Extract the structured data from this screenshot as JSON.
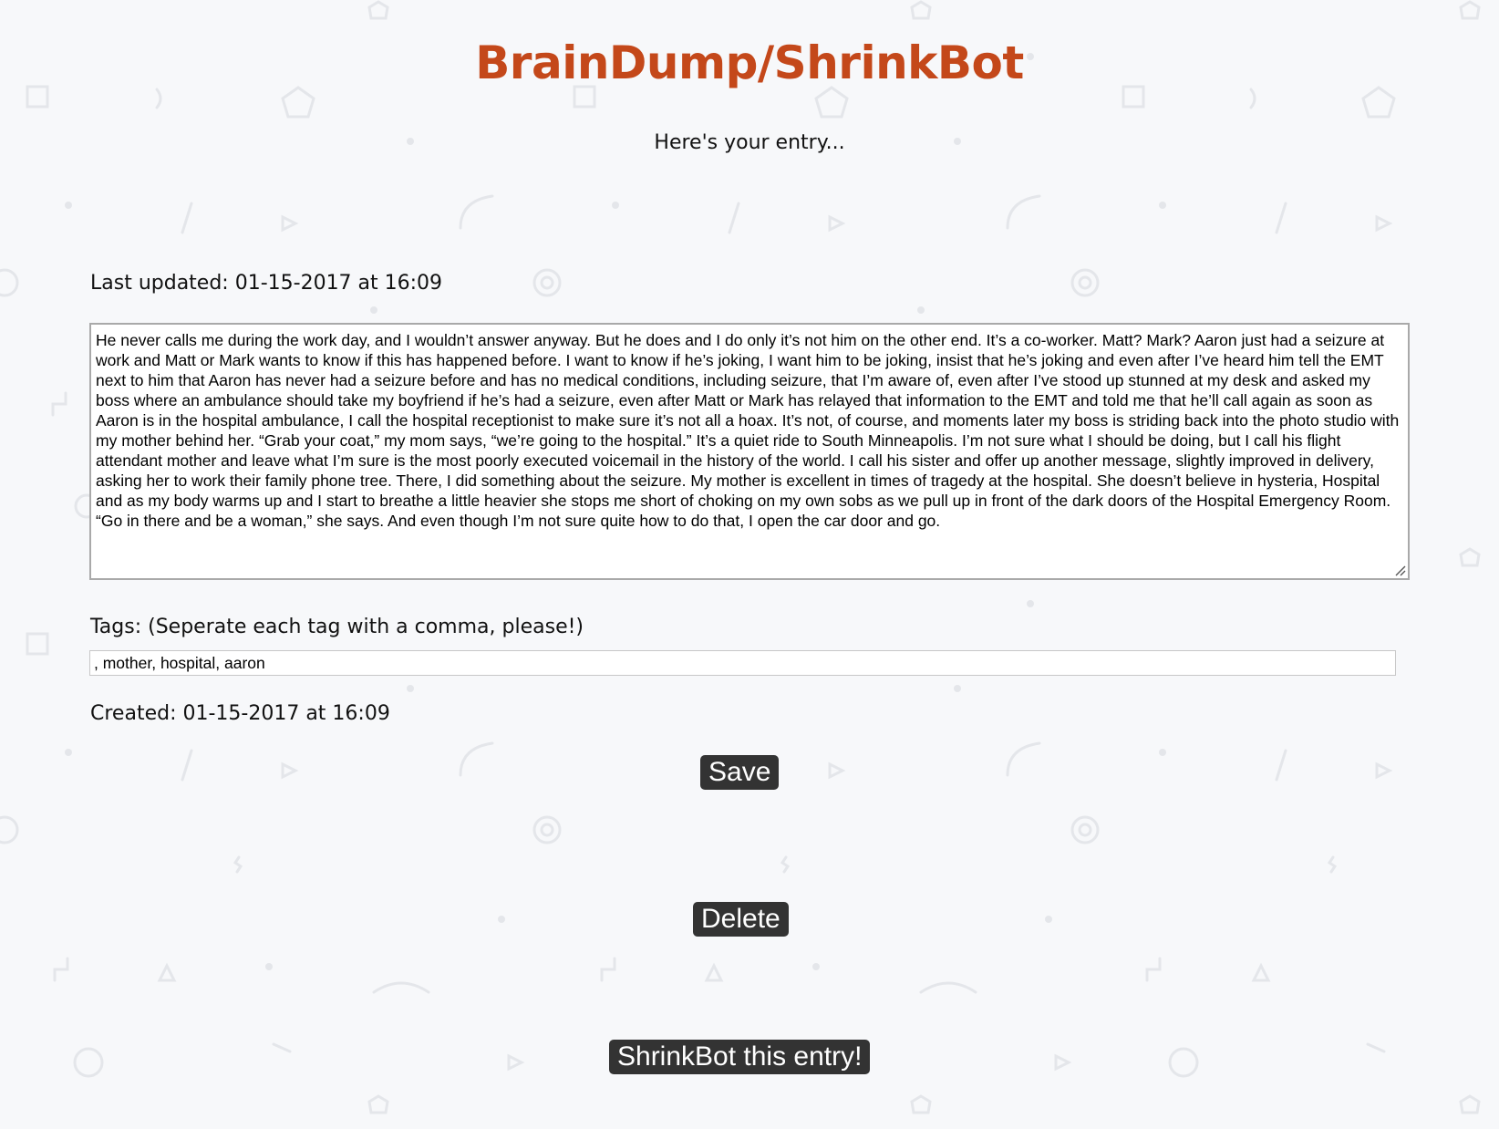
{
  "header": {
    "title": "BrainDump/ShrinkBot",
    "subtitle": "Here's your entry..."
  },
  "entry": {
    "last_updated": "Last updated: 01-15-2017 at 16:09",
    "body": "He never calls me during the work day, and I wouldn’t answer anyway. But he does and I do only it’s not him on the other end. It’s a co-worker. Matt? Mark? Aaron just had a seizure at work and Matt or Mark wants to know if this has happened before. I want to know if he’s joking, I want him to be joking, insist that he’s joking and even after I’ve heard him tell the EMT next to him that Aaron has never had a seizure before and has no medical conditions, including seizure, that I’m aware of, even after I’ve stood up stunned at my desk and asked my boss where an ambulance should take my boyfriend if he’s had a seizure, even after Matt or Mark has relayed that information to the EMT and told me that he’ll call again as soon as Aaron is in the hospital ambulance, I call the hospital receptionist to make sure it’s not all a hoax. It’s not, of course, and moments later my boss is striding back into the photo studio with my mother behind her. “Grab your coat,” my mom says, “we’re going to the hospital.” It’s a quiet ride to South Minneapolis. I’m not sure what I should be doing, but I call his flight attendant mother and leave what I’m sure is the most poorly executed voicemail in the history of the world. I call his sister and offer up another message, slightly improved in delivery, asking her to work their family phone tree. There, I did something about the seizure. My mother is excellent in times of tragedy at the hospital. She doesn’t believe in hysteria, Hospital and as my body warms up and I start to breathe a little heavier she stops me short of choking on my own sobs as we pull up in front of the dark doors of the Hospital Emergency Room. “Go in there and be a woman,” she says. And even though I’m not sure quite how to do that, I open the car door and go.",
    "tags_label": "Tags: (Seperate each tag with a comma, please!)",
    "tags_value": ", mother, hospital, aaron",
    "created": "Created: 01-15-2017 at 16:09"
  },
  "actions": {
    "save_label": "Save",
    "delete_label": "Delete",
    "shrinkbot_label": "ShrinkBot this entry!"
  },
  "colors": {
    "title": "#c4481a",
    "button_bg": "#333333",
    "background": "#f7f8fa"
  }
}
